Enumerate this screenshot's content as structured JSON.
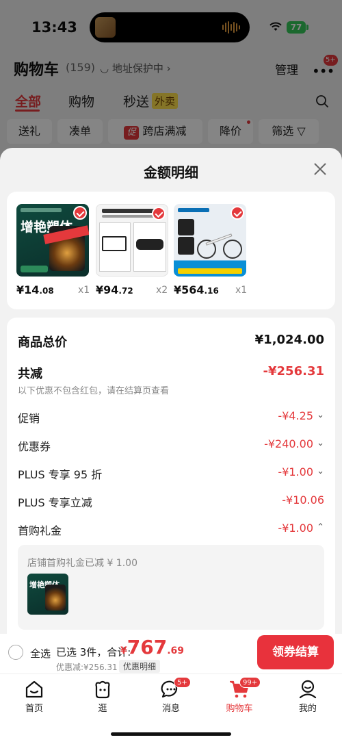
{
  "status_bar": {
    "time": "13:43",
    "battery": "77"
  },
  "header": {
    "title": "购物车",
    "count": "(159)",
    "address_protect": "地址保护中",
    "manage": "管理",
    "more_badge": "5+"
  },
  "tabs": [
    {
      "label": "全部"
    },
    {
      "label": "购物"
    },
    {
      "label": "秒送"
    }
  ],
  "tab_tag": "外卖",
  "filters": [
    {
      "label": "送礼"
    },
    {
      "label": "凑单"
    },
    {
      "label": "跨店满减"
    },
    {
      "label": "降价"
    },
    {
      "label": "筛选"
    }
  ],
  "filter_promo_tag": "促",
  "sheet": {
    "title": "金额明细",
    "products": [
      {
        "price_main": "¥14",
        "price_dec": ".08",
        "qty": "x1",
        "label": "增艳塑体"
      },
      {
        "price_main": "¥94",
        "price_dec": ".72",
        "qty": "x2"
      },
      {
        "price_main": "¥564",
        "price_dec": ".16",
        "qty": "x1"
      }
    ],
    "total_label": "商品总价",
    "total_value": "¥1,024.00",
    "reduce_label": "共减",
    "reduce_value": "-¥256.31",
    "reduce_note": "以下优惠不包含红包，请在结算页查看",
    "items": [
      {
        "label": "促销",
        "value": "-¥4.25",
        "chevron": "⌄"
      },
      {
        "label": "优惠券",
        "value": "-¥240.00",
        "chevron": "⌄"
      },
      {
        "label": "PLUS 专享 95 折",
        "value": "-¥1.00",
        "chevron": "⌄"
      },
      {
        "label": "PLUS 专享立减",
        "value": "-¥10.06",
        "chevron": ""
      },
      {
        "label": "首购礼金",
        "value": "-¥1.00",
        "chevron": "⌃"
      }
    ],
    "gift_note": "店铺首购礼金已减 ¥ 1.00"
  },
  "checkout": {
    "select_all": "全选",
    "selected": "已选 3件，合计:",
    "price_symbol": "¥",
    "price_int": "767",
    "price_dec": ".69",
    "discount": "优惠减:¥256.31",
    "detail": "优惠明细",
    "button": "领券结算"
  },
  "nav": [
    {
      "label": "首页"
    },
    {
      "label": "逛"
    },
    {
      "label": "消息",
      "badge": "5+"
    },
    {
      "label": "购物车",
      "badge": "99+"
    },
    {
      "label": "我的"
    }
  ],
  "colors": {
    "accent": "#e4393c",
    "battery": "#34c759"
  }
}
